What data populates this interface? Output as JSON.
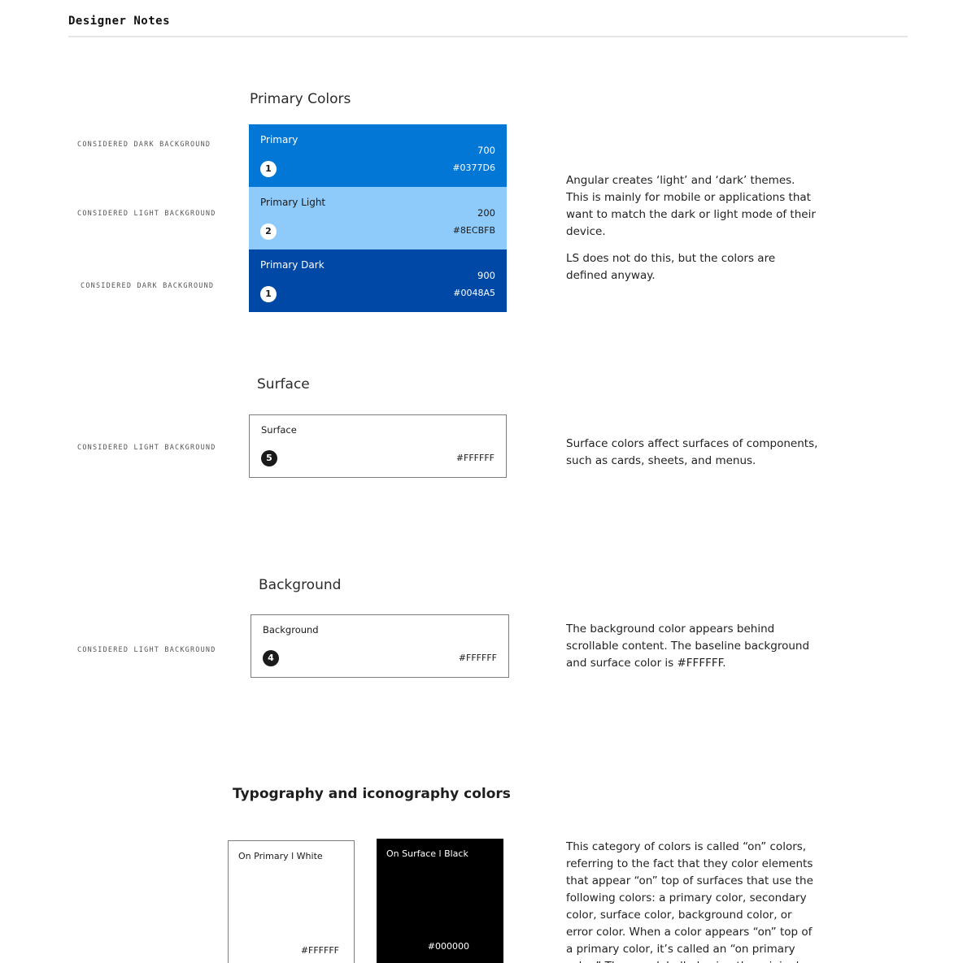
{
  "header": {
    "title": "Designer Notes"
  },
  "primary_section": {
    "title": "Primary Colors",
    "swatches": [
      {
        "name": "Primary",
        "shade": "700",
        "hex": "#0377D6",
        "badge": "1",
        "label": "CONSIDERED DARK BACKGROUND",
        "color": "#0377D6",
        "text_color": "#ffffff"
      },
      {
        "name": "Primary Light",
        "shade": "200",
        "hex": "#8ECBFB",
        "badge": "2",
        "label": "CONSIDERED LIGHT BACKGROUND",
        "color": "#8ECBFB",
        "text_color": "#1a1a1a"
      },
      {
        "name": "Primary  Dark",
        "shade": "900",
        "hex": "#0048A5",
        "badge": "1",
        "label": "CONSIDERED DARK BACKGROUND",
        "color": "#0048A5",
        "text_color": "#ffffff"
      }
    ],
    "note": [
      "Angular creates ‘light’ and ‘dark’ themes. This is mainly for mobile or applications that want to match the dark or light mode of their device.",
      "LS does not do this, but the colors are defined anyway."
    ]
  },
  "surface_section": {
    "title": "Surface",
    "label": "CONSIDERED LIGHT BACKGROUND",
    "swatch": {
      "name": "Surface",
      "hex": "#FFFFFF",
      "badge": "5"
    },
    "note": "Surface colors affect surfaces of components, such as cards, sheets, and menus."
  },
  "background_section": {
    "title": "Background",
    "label": "CONSIDERED LIGHT BACKGROUND",
    "swatch": {
      "name": "Background",
      "hex": "#FFFFFF",
      "badge": "4"
    },
    "note": "The background color appears behind scrollable content. The baseline background and surface color is #FFFFFF."
  },
  "typography_section": {
    "title": "Typography and iconography colors",
    "cards": [
      {
        "name": "On Primary l White",
        "hex": "#FFFFFF",
        "color": "#FFFFFF",
        "text_color": "#1a1a1a"
      },
      {
        "name": "On Surface l Black",
        "hex": "#000000",
        "color": "#000000",
        "text_color": "#ffffff"
      }
    ],
    "note": "This category of colors is called “on” colors, referring to the fact that they color elements that appear “on” top of surfaces that use the following colors: a primary color, secondary color, surface color, background color, or error color. When a color appears “on” top of a primary color, it’s called an “on primary color.” They are labelled using the original color category (such as primary color) with the prefix “on.”"
  }
}
